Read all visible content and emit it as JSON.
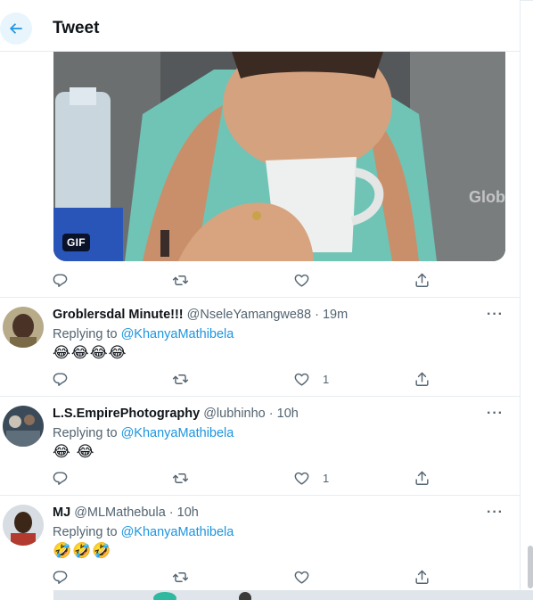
{
  "header": {
    "title": "Tweet"
  },
  "media": {
    "badge": "GIF",
    "watermark": "Glob"
  },
  "main_actions": {
    "like_count": "",
    "reply_count": ""
  },
  "replies": [
    {
      "name": "Groblersdal Minute!!!",
      "handle": "@NseleYamangwe88",
      "dot": "·",
      "time": "19m",
      "replying_prefix": "Replying to",
      "mention": "@KhanyaMathibela",
      "emojis": "😂😂😂😂",
      "like_count": "1",
      "more": "···"
    },
    {
      "name": "L.S.EmpirePhotography",
      "handle": "@lubhinho",
      "dot": "·",
      "time": "10h",
      "replying_prefix": "Replying to",
      "mention": "@KhanyaMathibela",
      "emojis": "😂 😂",
      "like_count": "1",
      "more": "···"
    },
    {
      "name": "MJ",
      "handle": "@MLMathebula",
      "dot": "·",
      "time": "10h",
      "replying_prefix": "Replying to",
      "mention": "@KhanyaMathibela",
      "emojis": "🤣🤣🤣",
      "like_count": "",
      "more": "···"
    }
  ],
  "colors": {
    "accent": "#1b95e0",
    "text_secondary": "#536471",
    "border": "#e6ecf0"
  },
  "icons": [
    "back-arrow-icon",
    "reply-icon",
    "retweet-icon",
    "like-icon",
    "share-icon",
    "more-icon"
  ]
}
